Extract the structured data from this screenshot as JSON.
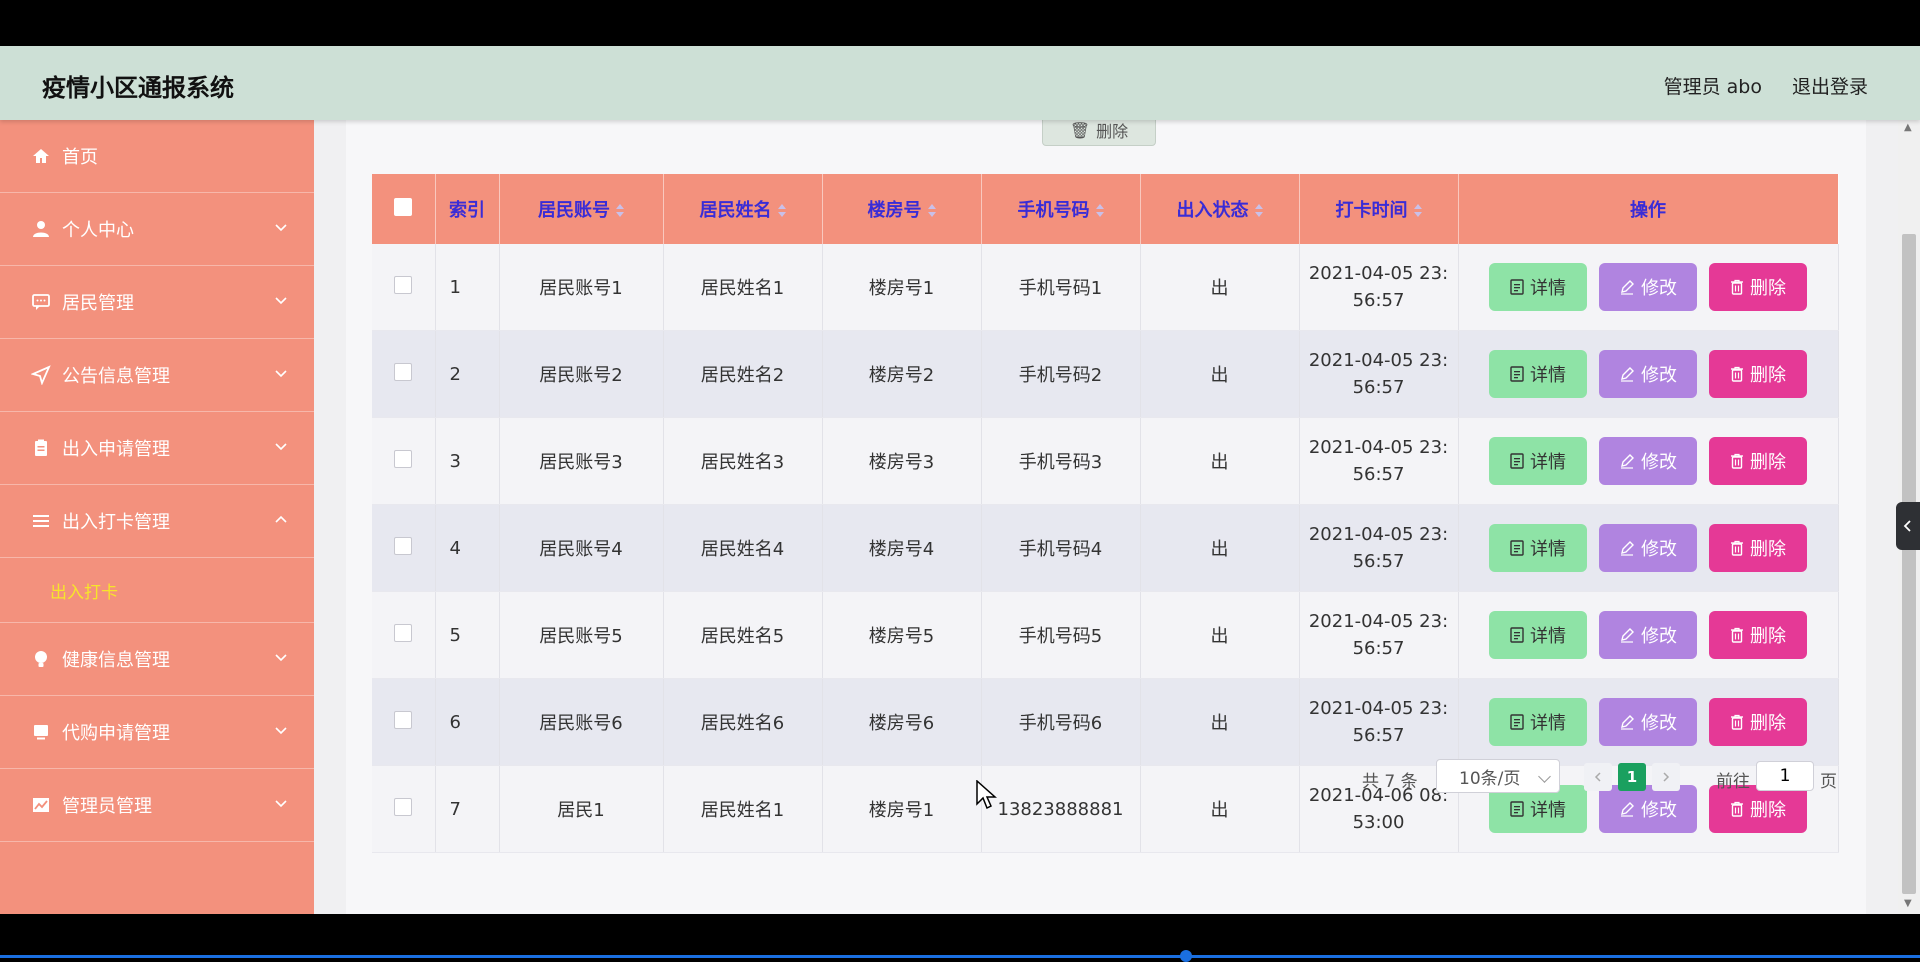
{
  "header": {
    "title": "疫情小区通报系统",
    "user": "管理员 abo",
    "logout": "退出登录"
  },
  "sidebar": {
    "items": [
      {
        "label": "首页",
        "icon": "home-icon"
      },
      {
        "label": "个人中心",
        "icon": "user-icon"
      },
      {
        "label": "居民管理",
        "icon": "message-icon"
      },
      {
        "label": "公告信息管理",
        "icon": "send-icon"
      },
      {
        "label": "出入申请管理",
        "icon": "clipboard-icon"
      },
      {
        "label": "出入打卡管理",
        "icon": "list-icon"
      },
      {
        "label": "健康信息管理",
        "icon": "bulb-icon"
      },
      {
        "label": "代购申请管理",
        "icon": "monitor-icon"
      },
      {
        "label": "管理员管理",
        "icon": "chart-icon"
      }
    ],
    "submenu": {
      "label": "出入打卡"
    }
  },
  "toolbar": {
    "delete_label": "删除"
  },
  "table": {
    "headers": [
      "索引",
      "居民账号",
      "居民姓名",
      "楼房号",
      "手机号码",
      "出入状态",
      "打卡时间",
      "操作"
    ],
    "rows": [
      {
        "index": "1",
        "account": "居民账号1",
        "name": "居民姓名1",
        "building": "楼房号1",
        "phone": "手机号码1",
        "status": "出",
        "time_a": "2021-04-05 23:",
        "time_b": "56:57"
      },
      {
        "index": "2",
        "account": "居民账号2",
        "name": "居民姓名2",
        "building": "楼房号2",
        "phone": "手机号码2",
        "status": "出",
        "time_a": "2021-04-05 23:",
        "time_b": "56:57"
      },
      {
        "index": "3",
        "account": "居民账号3",
        "name": "居民姓名3",
        "building": "楼房号3",
        "phone": "手机号码3",
        "status": "出",
        "time_a": "2021-04-05 23:",
        "time_b": "56:57"
      },
      {
        "index": "4",
        "account": "居民账号4",
        "name": "居民姓名4",
        "building": "楼房号4",
        "phone": "手机号码4",
        "status": "出",
        "time_a": "2021-04-05 23:",
        "time_b": "56:57"
      },
      {
        "index": "5",
        "account": "居民账号5",
        "name": "居民姓名5",
        "building": "楼房号5",
        "phone": "手机号码5",
        "status": "出",
        "time_a": "2021-04-05 23:",
        "time_b": "56:57"
      },
      {
        "index": "6",
        "account": "居民账号6",
        "name": "居民姓名6",
        "building": "楼房号6",
        "phone": "手机号码6",
        "status": "出",
        "time_a": "2021-04-05 23:",
        "time_b": "56:57"
      },
      {
        "index": "7",
        "account": "居民1",
        "name": "居民姓名1",
        "building": "楼房号1",
        "phone": "13823888881",
        "status": "出",
        "time_a": "2021-04-06 08:",
        "time_b": "53:00"
      }
    ],
    "actions": {
      "detail": "详情",
      "edit": "修改",
      "delete": "删除"
    }
  },
  "pagination": {
    "total": "共 7 条",
    "page_size": "10条/页",
    "current": "1",
    "goto_prefix": "前往",
    "goto_value": "1",
    "goto_suffix": "页"
  },
  "colors": {
    "sidebar": "#f3917d",
    "header": "#cde0d6",
    "detail": "#8ee3a6",
    "edit": "#b084e0",
    "delete": "#e53996",
    "header_text": "#3a2cd6"
  }
}
